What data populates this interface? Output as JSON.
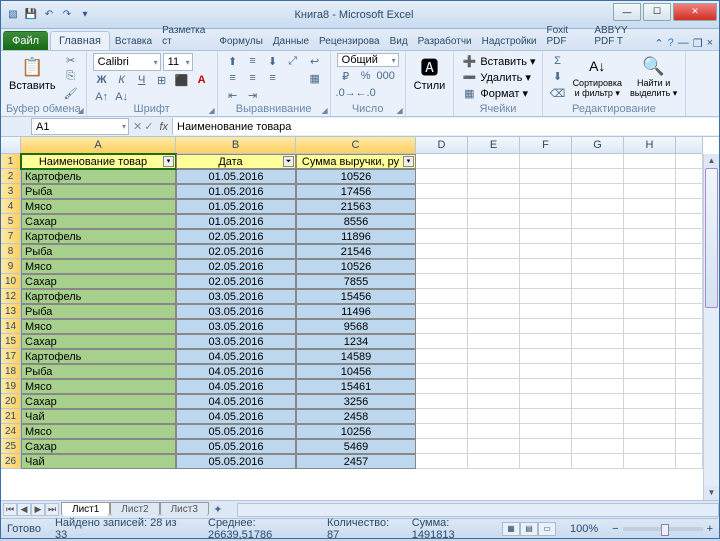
{
  "title": "Книга8 - Microsoft Excel",
  "qat": [
    "X",
    "💾",
    "↶",
    "↷",
    "▾"
  ],
  "tabs": {
    "file": "Файл",
    "items": [
      "Главная",
      "Вставка",
      "Разметка ст",
      "Формулы",
      "Данные",
      "Рецензирова",
      "Вид",
      "Разработчи",
      "Надстройки",
      "Foxit PDF",
      "ABBYY PDF T"
    ]
  },
  "ribbon": {
    "paste": "Вставить",
    "font_name": "Calibri",
    "font_size": "11",
    "num_format": "Общий",
    "styles": "Стили",
    "insert": "Вставить ▾",
    "delete": "Удалить ▾",
    "format": "Формат ▾",
    "sort": "Сортировка\nи фильтр ▾",
    "find": "Найти и\nвыделить ▾",
    "g_clip": "Буфер обмена",
    "g_font": "Шрифт",
    "g_align": "Выравнивание",
    "g_num": "Число",
    "g_cells": "Ячейки",
    "g_edit": "Редактирование"
  },
  "name_box": "A1",
  "formula": "Наименование товара",
  "cols": [
    "A",
    "B",
    "C",
    "D",
    "E",
    "F",
    "G",
    "H"
  ],
  "chart_data": {
    "type": "table",
    "headers": [
      "Наименование товар",
      "Дата",
      "Сумма выручки, ру"
    ],
    "rows": [
      {
        "n": "2",
        "a": "Картофель",
        "b": "01.05.2016",
        "c": "10526"
      },
      {
        "n": "3",
        "a": "Рыба",
        "b": "01.05.2016",
        "c": "17456"
      },
      {
        "n": "4",
        "a": "Мясо",
        "b": "01.05.2016",
        "c": "21563"
      },
      {
        "n": "5",
        "a": "Сахар",
        "b": "01.05.2016",
        "c": "8556"
      },
      {
        "n": "7",
        "a": "Картофель",
        "b": "02.05.2016",
        "c": "11896"
      },
      {
        "n": "8",
        "a": "Рыба",
        "b": "02.05.2016",
        "c": "21546"
      },
      {
        "n": "9",
        "a": "Мясо",
        "b": "02.05.2016",
        "c": "10526"
      },
      {
        "n": "10",
        "a": "Сахар",
        "b": "02.05.2016",
        "c": "7855"
      },
      {
        "n": "12",
        "a": "Картофель",
        "b": "03.05.2016",
        "c": "15456"
      },
      {
        "n": "13",
        "a": "Рыба",
        "b": "03.05.2016",
        "c": "11496"
      },
      {
        "n": "14",
        "a": "Мясо",
        "b": "03.05.2016",
        "c": "9568"
      },
      {
        "n": "15",
        "a": "Сахар",
        "b": "03.05.2016",
        "c": "1234"
      },
      {
        "n": "17",
        "a": "Картофель",
        "b": "04.05.2016",
        "c": "14589"
      },
      {
        "n": "18",
        "a": "Рыба",
        "b": "04.05.2016",
        "c": "10456"
      },
      {
        "n": "19",
        "a": "Мясо",
        "b": "04.05.2016",
        "c": "15461"
      },
      {
        "n": "20",
        "a": "Сахар",
        "b": "04.05.2016",
        "c": "3256"
      },
      {
        "n": "21",
        "a": "Чай",
        "b": "04.05.2016",
        "c": "2458"
      },
      {
        "n": "24",
        "a": "Мясо",
        "b": "05.05.2016",
        "c": "10256"
      },
      {
        "n": "25",
        "a": "Сахар",
        "b": "05.05.2016",
        "c": "5469"
      },
      {
        "n": "26",
        "a": "Чай",
        "b": "05.05.2016",
        "c": "2457"
      }
    ]
  },
  "sheets": [
    "Лист1",
    "Лист2",
    "Лист3"
  ],
  "status": {
    "ready": "Готово",
    "found": "Найдено записей: 28 из 33",
    "avg": "Среднее: 26639,51786",
    "count": "Количество: 87",
    "sum": "Сумма: 1491813",
    "zoom": "100%"
  }
}
